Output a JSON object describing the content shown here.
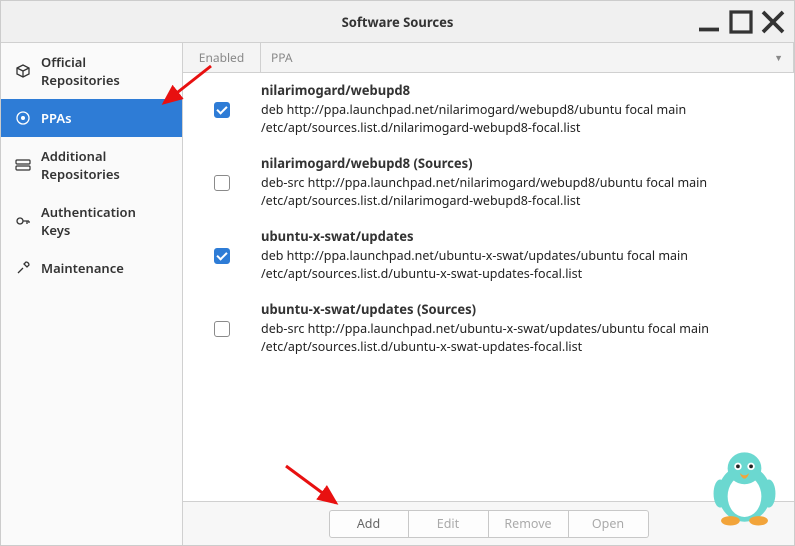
{
  "window": {
    "title": "Software Sources"
  },
  "sidebar": {
    "items": [
      {
        "label": "Official Repositories"
      },
      {
        "label": "PPAs"
      },
      {
        "label": "Additional Repositories"
      },
      {
        "label": "Authentication Keys"
      },
      {
        "label": "Maintenance"
      }
    ]
  },
  "columns": {
    "enabled": "Enabled",
    "ppa": "PPA"
  },
  "ppas": [
    {
      "checked": true,
      "name": "nilarimogard/webupd8",
      "line": "deb http://ppa.launchpad.net/nilarimogard/webupd8/ubuntu focal main",
      "file": "/etc/apt/sources.list.d/nilarimogard-webupd8-focal.list"
    },
    {
      "checked": false,
      "name": "nilarimogard/webupd8 (Sources)",
      "line": "deb-src http://ppa.launchpad.net/nilarimogard/webupd8/ubuntu focal main",
      "file": "/etc/apt/sources.list.d/nilarimogard-webupd8-focal.list"
    },
    {
      "checked": true,
      "name": "ubuntu-x-swat/updates",
      "line": "deb http://ppa.launchpad.net/ubuntu-x-swat/updates/ubuntu focal main",
      "file": "/etc/apt/sources.list.d/ubuntu-x-swat-updates-focal.list"
    },
    {
      "checked": false,
      "name": "ubuntu-x-swat/updates (Sources)",
      "line": "deb-src http://ppa.launchpad.net/ubuntu-x-swat/updates/ubuntu focal main",
      "file": "/etc/apt/sources.list.d/ubuntu-x-swat-updates-focal.list"
    }
  ],
  "buttons": {
    "add": "Add",
    "edit": "Edit",
    "remove": "Remove",
    "open": "Open"
  }
}
